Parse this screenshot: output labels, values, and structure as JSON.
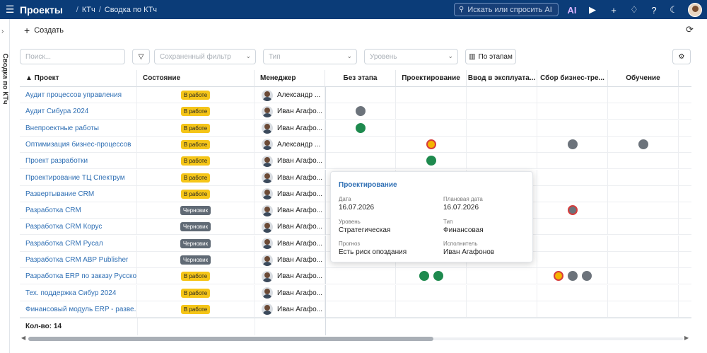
{
  "header": {
    "app_title": "Проекты",
    "breadcrumbs": [
      "КТч",
      "Сводка по КТч"
    ],
    "search_placeholder": "Искать или спросить AI",
    "ai_label": "AI"
  },
  "sidebar": {
    "vertical_label": "Сводка по КТч"
  },
  "toolbar": {
    "create_label": "Создать"
  },
  "filters": {
    "search_placeholder": "Поиск...",
    "saved_filter_placeholder": "Сохраненный фильтр",
    "type_placeholder": "Тип",
    "level_placeholder": "Уровень",
    "by_stages_label": "По этапам"
  },
  "columns": {
    "project": "▲ Проект",
    "state": "Состояние",
    "manager": "Менеджер",
    "stages": [
      "Без этапа",
      "Проектирование",
      "Ввод в эксплуата...",
      "Сбор бизнес-тре...",
      "Обучение"
    ]
  },
  "rows": [
    {
      "project": "Аудит процессов управления",
      "state": "В работе",
      "kind": "work",
      "manager": "Александр ...",
      "dots": []
    },
    {
      "project": "Аудит Сибура 2024",
      "state": "В работе",
      "kind": "work",
      "manager": "Иван Агафо...",
      "dots": [
        {
          "col": 0,
          "status": "gray"
        }
      ]
    },
    {
      "project": "Внепроектные работы",
      "state": "В работе",
      "kind": "work",
      "manager": "Иван Агафо...",
      "dots": [
        {
          "col": 0,
          "status": "green"
        }
      ]
    },
    {
      "project": "Оптимизация бизнес-процессов",
      "state": "В работе",
      "kind": "work",
      "manager": "Александр ...",
      "dots": [
        {
          "col": 1,
          "status": "orange"
        },
        {
          "col": 3,
          "status": "gray"
        },
        {
          "col": 4,
          "status": "gray"
        }
      ]
    },
    {
      "project": "Проект разработки",
      "state": "В работе",
      "kind": "work",
      "manager": "Иван Агафо...",
      "dots": [
        {
          "col": 1,
          "status": "green"
        }
      ]
    },
    {
      "project": "Проектирование ТЦ Спектрум",
      "state": "В работе",
      "kind": "work",
      "manager": "Иван Агафо...",
      "dots": []
    },
    {
      "project": "Развертывание CRM",
      "state": "В работе",
      "kind": "work",
      "manager": "Иван Агафо...",
      "dots": []
    },
    {
      "project": "Разработка CRM",
      "state": "Черновик",
      "kind": "draft",
      "manager": "Иван Агафо...",
      "dots": [
        {
          "col": 3,
          "status": "gray-red"
        }
      ]
    },
    {
      "project": "Разработка CRM Корус",
      "state": "Черновик",
      "kind": "draft",
      "manager": "Иван Агафо...",
      "dots": []
    },
    {
      "project": "Разработка CRM Русал",
      "state": "Черновик",
      "kind": "draft",
      "manager": "Иван Агафо...",
      "dots": []
    },
    {
      "project": "Разработка CRM ABP Publisher",
      "state": "Черновик",
      "kind": "draft",
      "manager": "Иван Агафо...",
      "dots": []
    },
    {
      "project": "Разработка ERP по заказу Русско...",
      "state": "В работе",
      "kind": "work",
      "manager": "Иван Агафо...",
      "dots": [
        {
          "col": 1,
          "status": "green"
        },
        {
          "col": 1,
          "status": "green"
        },
        {
          "col": 3,
          "status": "orange"
        },
        {
          "col": 3,
          "status": "gray"
        },
        {
          "col": 3,
          "status": "gray"
        }
      ]
    },
    {
      "project": "Тех. поддержка Сибур 2024",
      "state": "В работе",
      "kind": "work",
      "manager": "Иван Агафо...",
      "dots": []
    },
    {
      "project": "Финансовый модуль ERP - разве...",
      "state": "В работе",
      "kind": "work",
      "manager": "Иван Агафо...",
      "dots": []
    }
  ],
  "footer": {
    "count_label": "Кол-во: 14"
  },
  "popover": {
    "title": "Проектирование",
    "date_label": "Дата",
    "date_value": "16.07.2026",
    "planned_label": "Плановая дата",
    "planned_value": "16.07.2026",
    "level_label": "Уровень",
    "level_value": "Стратегическая",
    "type_label": "Тип",
    "type_value": "Финансовая",
    "forecast_label": "Прогноз",
    "forecast_value": "Есть риск опоздания",
    "assignee_label": "Исполнитель",
    "assignee_value": "Иван Агафонов"
  },
  "colors": {
    "header_bg": "#0b3c78",
    "link": "#2f6fb4",
    "green": "#1e8a4e",
    "gray": "#6c737b",
    "orange": "#f5b400",
    "red_ring": "#d63c3c"
  }
}
